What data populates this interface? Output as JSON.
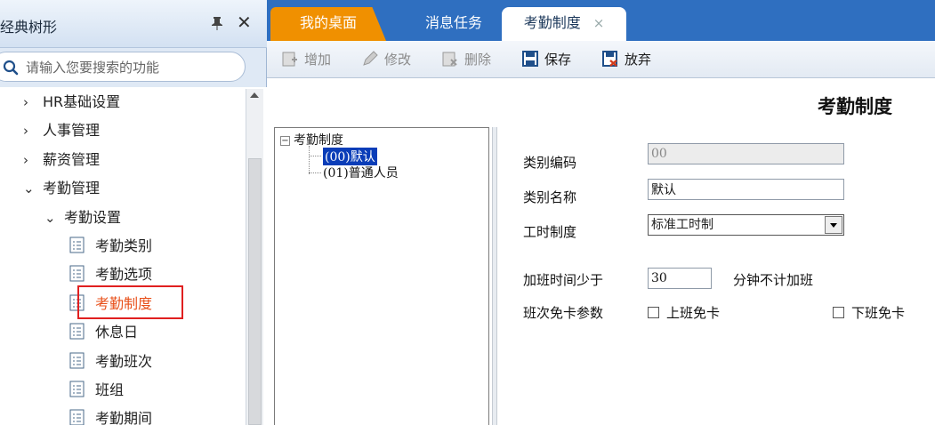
{
  "sidebar": {
    "title": "经典树形",
    "search_placeholder": "请输入您要搜索的功能",
    "items": [
      {
        "label": "HR基础设置",
        "arrow": "›"
      },
      {
        "label": "人事管理",
        "arrow": "›"
      },
      {
        "label": "薪资管理",
        "arrow": "›"
      },
      {
        "label": "考勤管理",
        "arrow": "⌄"
      },
      {
        "label": "考勤设置",
        "arrow": "⌄"
      },
      {
        "label": "考勤类别"
      },
      {
        "label": "考勤选项"
      },
      {
        "label": "考勤制度",
        "selected": true
      },
      {
        "label": "休息日"
      },
      {
        "label": "考勤班次"
      },
      {
        "label": "班组"
      },
      {
        "label": "考勤期间"
      }
    ],
    "selected_color": "#e8501a"
  },
  "tabs": [
    {
      "label": "我的桌面",
      "color": "#f09000"
    },
    {
      "label": "消息任务"
    },
    {
      "label": "考勤制度",
      "active": true,
      "close": "×"
    }
  ],
  "toolbar": {
    "add_label": "增加",
    "edit_label": "修改",
    "delete_label": "删除",
    "save_label": "保存",
    "discard_label": "放弃"
  },
  "page": {
    "title": "考勤制度"
  },
  "tree": {
    "root": "考勤制度",
    "toggle": "−",
    "children": [
      "(00)默认",
      "(01)普通人员"
    ]
  },
  "form": {
    "code_label": "类别编码",
    "code_value": "00",
    "name_label": "类别名称",
    "name_value": "默认",
    "system_label": "工时制度",
    "system_value": "标准工时制",
    "overtime_label": "加班时间少于",
    "overtime_value": "30",
    "overtime_suffix": "分钟不计加班",
    "card_label": "班次免卡参数",
    "on_duty_label": "上班免卡",
    "off_duty_label": "下班免卡"
  },
  "colors": {
    "tab_bar": "#2f6fc0",
    "highlight_border": "#e02020",
    "tree_selection": "#0a3db8"
  }
}
